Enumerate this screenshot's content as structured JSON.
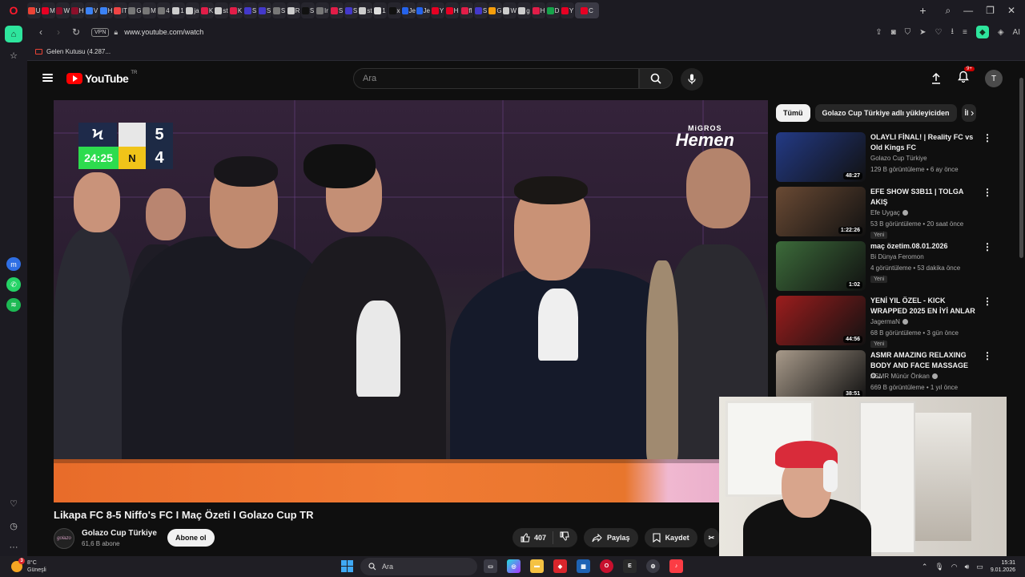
{
  "browser": {
    "url": "www.youtube.com/watch",
    "vpn_label": "VPN",
    "bookmark": "Gelen Kutusu (4.287..."
  },
  "tabs": [
    {
      "label": "U",
      "color": "#ea4335"
    },
    {
      "label": "M",
      "color": "#e60023"
    },
    {
      "label": "W",
      "color": "#8b0f2a"
    },
    {
      "label": "H",
      "color": "#8b0f2a"
    },
    {
      "label": "V",
      "color": "#3b82f6"
    },
    {
      "label": "H",
      "color": "#3b82f6"
    },
    {
      "label": "IT",
      "color": "#ef4444"
    },
    {
      "label": "G",
      "color": "#777777"
    },
    {
      "label": "M",
      "color": "#777777"
    },
    {
      "label": "4",
      "color": "#777777"
    },
    {
      "label": "1",
      "color": "#cccccc"
    },
    {
      "label": "ja",
      "color": "#cccccc"
    },
    {
      "label": "K",
      "color": "#e11d48"
    },
    {
      "label": "st",
      "color": "#cccccc"
    },
    {
      "label": "K",
      "color": "#e11d48"
    },
    {
      "label": "S",
      "color": "#4338ca"
    },
    {
      "label": "S",
      "color": "#4338ca"
    },
    {
      "label": "S",
      "color": "#777777"
    },
    {
      "label": "R",
      "color": "#cccccc"
    },
    {
      "label": "S",
      "color": "#111111"
    },
    {
      "label": "Ir",
      "color": "#777777"
    },
    {
      "label": "S",
      "color": "#e11d48"
    },
    {
      "label": "S",
      "color": "#4338ca"
    },
    {
      "label": "st",
      "color": "#cccccc"
    },
    {
      "label": "1",
      "color": "#dddddd"
    },
    {
      "label": "x",
      "color": "#111111"
    },
    {
      "label": "Je",
      "color": "#2563eb"
    },
    {
      "label": "Je",
      "color": "#2563eb"
    },
    {
      "label": "Y",
      "color": "#e60023"
    },
    {
      "label": "H",
      "color": "#e60023"
    },
    {
      "label": "fl",
      "color": "#e11d48"
    },
    {
      "label": "S",
      "color": "#4338ca"
    },
    {
      "label": "G",
      "color": "#f59e0b"
    },
    {
      "label": "W",
      "color": "#cccccc"
    },
    {
      "label": "g",
      "color": "#cccccc"
    },
    {
      "label": "H",
      "color": "#e11d48"
    },
    {
      "label": "D",
      "color": "#16a34a"
    },
    {
      "label": "Y",
      "color": "#e60023"
    },
    {
      "label": "C",
      "color": "#e60023"
    }
  ],
  "youtube": {
    "logo_text": "YouTube",
    "logo_region": "TR",
    "search_placeholder": "Ara",
    "notification_count": "9+",
    "avatar_initial": "T"
  },
  "video": {
    "title": "Likapa FC 8-5 Niffo's FC I Maç Özeti I Golazo Cup TR",
    "scoreboard": {
      "team1_logo": "Ϟ",
      "team2_logo": "N",
      "score1": "5",
      "score2": "4",
      "clock": "24:25"
    },
    "sponsor_top": "MiGROS",
    "sponsor_bottom": "Hemen"
  },
  "channel": {
    "avatar_text": "golazo",
    "name": "Golazo Cup Türkiye",
    "subscribers": "61,6 B abone",
    "subscribe_label": "Abone ol"
  },
  "actions": {
    "likes": "407",
    "share": "Paylaş",
    "save": "Kaydet"
  },
  "chips": [
    "Tümü",
    "Golazo Cup Türkiye adlı yükleyiciden",
    "İl"
  ],
  "recommendations": [
    {
      "title": "OLAYLI FİNAL! | Reality FC vs Old Kings FC",
      "channel": "Golazo Cup Türkiye",
      "verified": false,
      "meta": "129 B görüntüleme • 6 ay önce",
      "duration": "48:27",
      "new": "",
      "thumb": "#233a86"
    },
    {
      "title": "EFE SHOW S3B11 | TOLGA AKIŞ",
      "channel": "Efe Uygaç",
      "verified": true,
      "meta": "53 B görüntüleme • 20 saat önce",
      "duration": "1:22:26",
      "new": "Yeni",
      "thumb": "#6a4a34"
    },
    {
      "title": "maç özetim.08.01.2026",
      "channel": "Bi Dünya Feromon",
      "verified": false,
      "meta": "4 görüntüleme • 53 dakika önce",
      "duration": "1:02",
      "new": "Yeni",
      "thumb": "#3c6b3a"
    },
    {
      "title": "YENİ YIL ÖZEL - KICK WRAPPED 2025 EN İYİ ANLAR",
      "channel": "JagermaN",
      "verified": true,
      "meta": "68 B görüntüleme • 3 gün önce",
      "duration": "44:56",
      "new": "Yeni",
      "thumb": "#9c1d1d"
    },
    {
      "title": "ASMR AMAZING RELAXING BODY AND FACE MASSAGE O...",
      "channel": "ASMR Münür Önkan",
      "verified": true,
      "meta": "669 B görüntüleme • 1 yıl önce",
      "duration": "38:51",
      "new": "",
      "thumb": "#a89a8a"
    }
  ],
  "taskbar": {
    "temperature": "8°C",
    "weather": "Güneşli",
    "weather_badge": "3",
    "search_placeholder": "Ara",
    "time": "15:31",
    "date": "9.01.2026"
  }
}
